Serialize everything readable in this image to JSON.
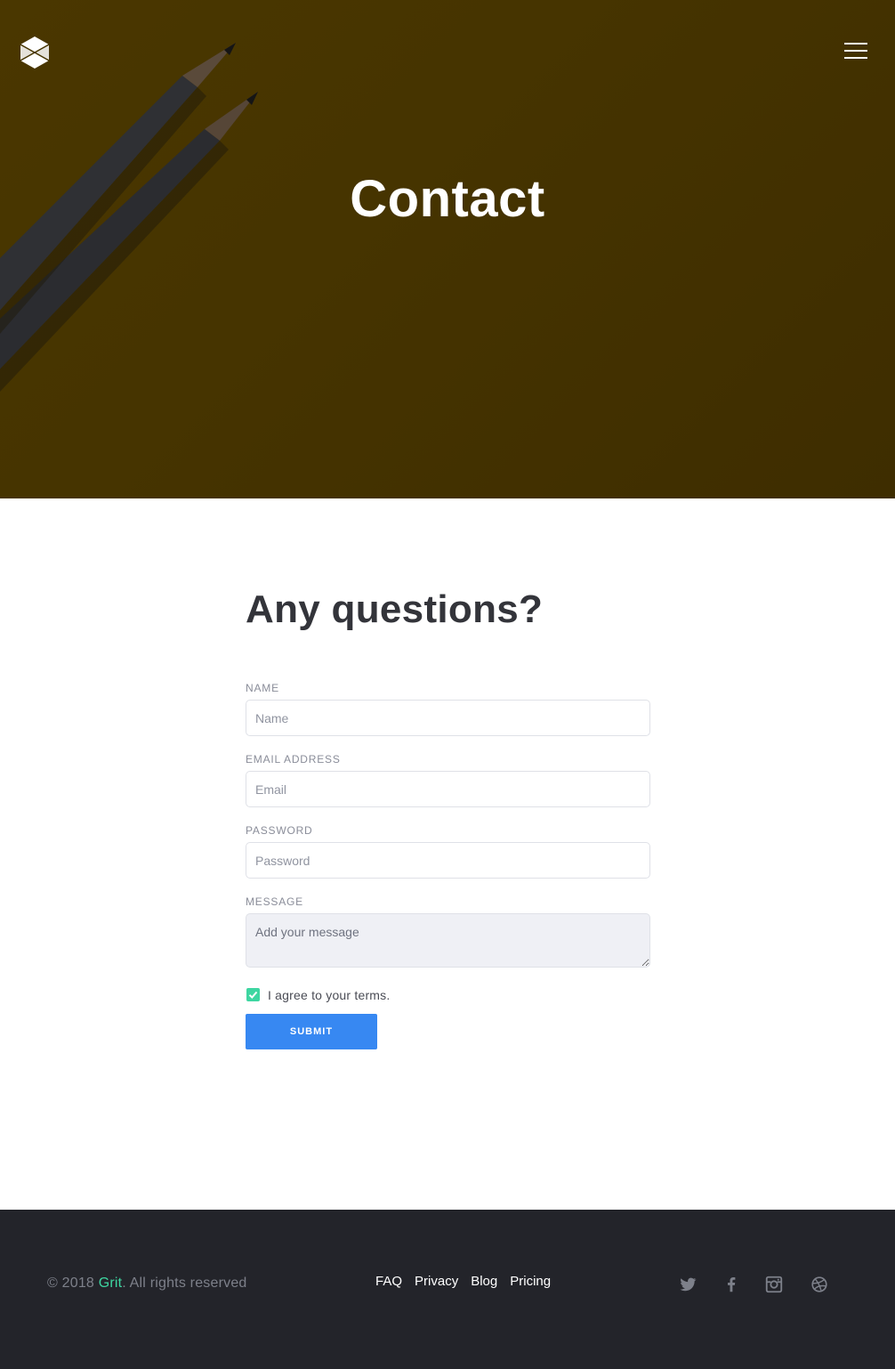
{
  "hero": {
    "title": "Contact"
  },
  "form": {
    "heading": "Any questions?",
    "name_label": "Name",
    "name_placeholder": "Name",
    "email_label": "Email address",
    "email_placeholder": "Email",
    "password_label": "Password",
    "password_placeholder": "Password",
    "message_label": "Message",
    "message_placeholder": "Add your message",
    "terms_checked": true,
    "terms_label": "I agree to your terms.",
    "submit_label": "Submit"
  },
  "footer": {
    "copyright_prefix": "© 2018 ",
    "brand": "Grit",
    "copyright_suffix": ". All rights reserved",
    "links": [
      "FAQ",
      "Privacy",
      "Blog",
      "Pricing"
    ],
    "social_icons": [
      "twitter-icon",
      "facebook-icon",
      "instagram-icon",
      "dribbble-icon"
    ]
  },
  "colors": {
    "hero_background": "#463400",
    "accent_green": "#3ed6a1",
    "button_blue": "#3788f2",
    "footer_background": "#23242a"
  }
}
